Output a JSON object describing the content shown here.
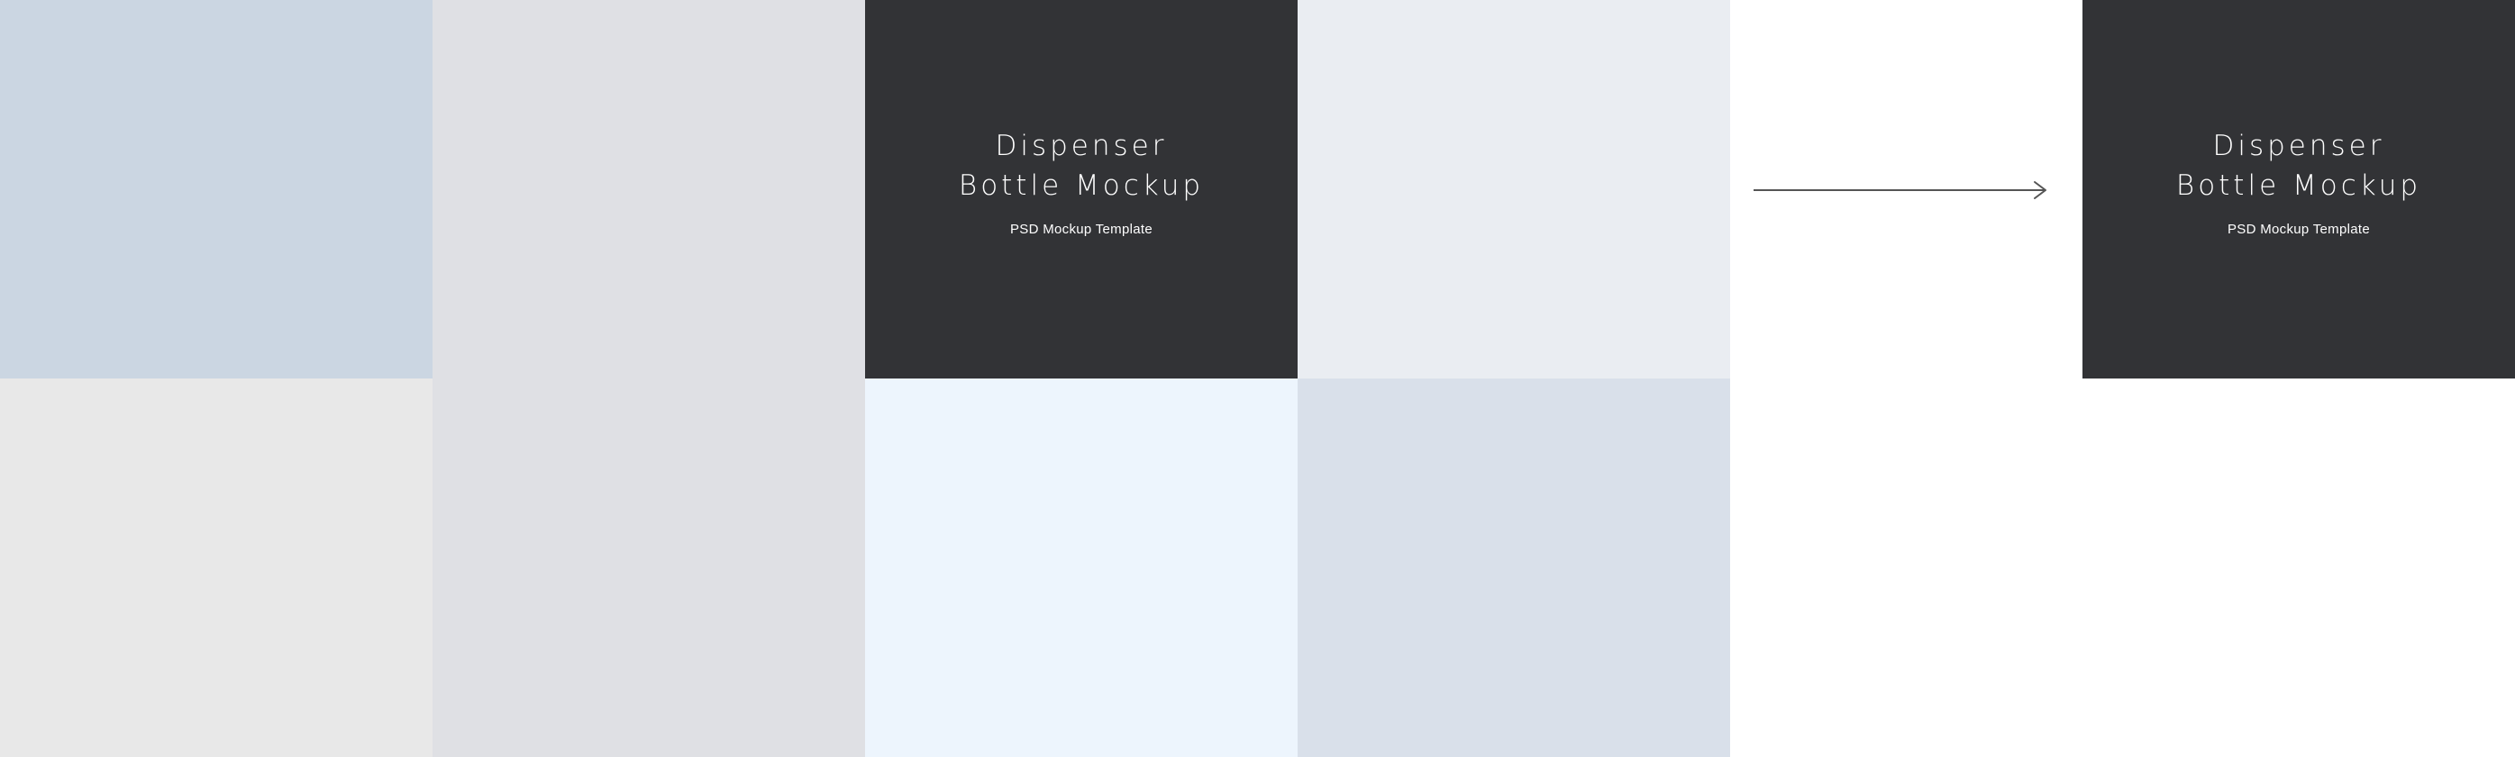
{
  "swatches": {
    "tile1": "#CBD6E2",
    "tile2": "#DFE0E4",
    "tile3": "#323336",
    "tile4": "#EAEDF2",
    "tile5": "#E8E8E8",
    "tile6": "#EDF5FD",
    "tile7": "#D9E0EA",
    "tile8": "#323336"
  },
  "card_left": {
    "title_line1": "Dispenser",
    "title_line2": "Bottle Mockup",
    "subtitle": "PSD Mockup Template"
  },
  "card_right": {
    "title_line1": "Dispenser",
    "title_line2": "Bottle Mockup",
    "subtitle": "PSD Mockup Template"
  },
  "arrow": {
    "icon": "arrow-right-icon",
    "color": "#555555"
  }
}
